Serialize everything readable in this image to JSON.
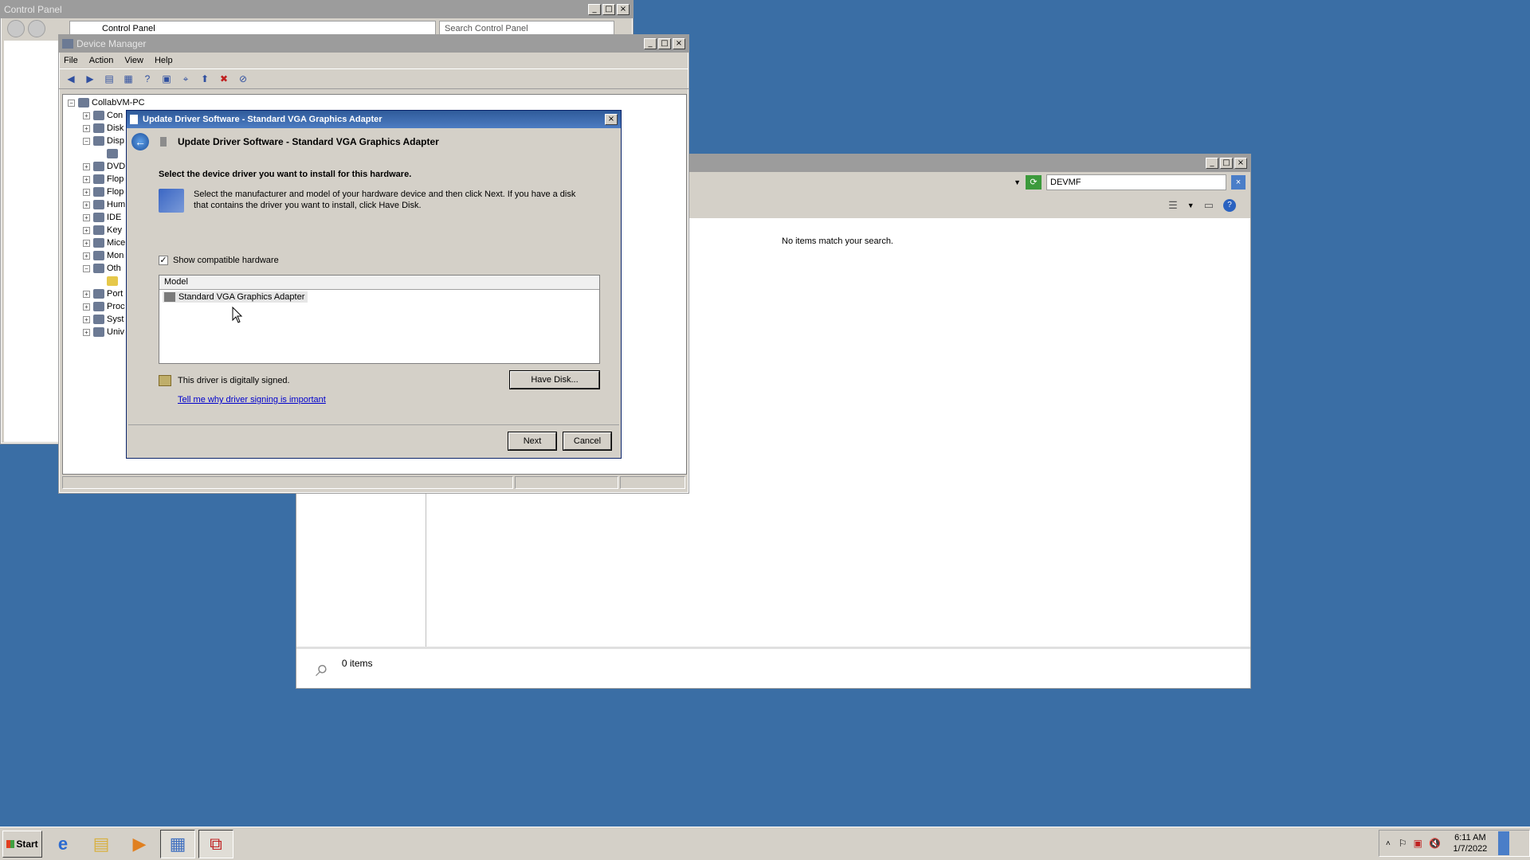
{
  "control_panel": {
    "title": "Control Panel",
    "breadcrumb": "Control Panel",
    "search_placeholder": "Search Control Panel"
  },
  "search_window": {
    "search_value": "DEVMF",
    "no_items_text": "No items match your search.",
    "item_count": "0 items"
  },
  "device_manager": {
    "title": "Device Manager",
    "menu": [
      "File",
      "Action",
      "View",
      "Help"
    ],
    "tree_root": "CollabVM-PC",
    "tree_items": [
      "Con",
      "Disk",
      "Disp",
      "",
      "DVD",
      "Flop",
      "Flop",
      "Hum",
      "IDE",
      "Key",
      "Mice",
      "Mon",
      "Oth",
      "",
      "Port",
      "Proc",
      "Syst",
      "Univ"
    ]
  },
  "dialog": {
    "title": "Update Driver Software - Standard VGA Graphics Adapter",
    "header": "Update Driver Software - Standard VGA Graphics Adapter",
    "heading": "Select the device driver you want to install for this hardware.",
    "description": "Select the manufacturer and model of your hardware device and then click Next. If you have a disk that contains the driver you want to install, click Have Disk.",
    "show_compatible_label": "Show compatible hardware",
    "show_compatible_checked": true,
    "list_header": "Model",
    "models": [
      "Standard VGA Graphics Adapter"
    ],
    "signed_text": "This driver is digitally signed.",
    "signing_link": "Tell me why driver signing is important",
    "have_disk_label": "Have Disk...",
    "next_label": "Next",
    "cancel_label": "Cancel"
  },
  "taskbar": {
    "start_label": "Start",
    "time": "6:11 AM",
    "date": "1/7/2022"
  }
}
